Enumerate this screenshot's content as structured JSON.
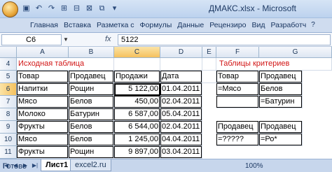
{
  "window": {
    "title": "ДМАКС.xlsx - Microsoft"
  },
  "ribbon": {
    "tabs": [
      "Главная",
      "Вставка",
      "Разметка с",
      "Формулы",
      "Данные",
      "Рецензиро",
      "Вид",
      "Разработч"
    ]
  },
  "formula_bar": {
    "name_box": "C6",
    "fx": "fx",
    "value": "5122"
  },
  "columns": [
    "A",
    "B",
    "C",
    "D",
    "E",
    "F",
    "G"
  ],
  "rows": [
    "4",
    "5",
    "6",
    "7",
    "8",
    "9",
    "10",
    "11"
  ],
  "sheet": {
    "left_title": "Исходная таблица",
    "right_title": "Таблицы критериев",
    "headers": [
      "Товар",
      "Продавец",
      "Продажи",
      "Дата"
    ],
    "data": [
      [
        "Напитки",
        "Рощин",
        "5 122,00",
        "01.04.2011"
      ],
      [
        "Мясо",
        "Белов",
        "450,00",
        "02.04.2011"
      ],
      [
        "Молоко",
        "Батурин",
        "6 587,00",
        "05.04.2011"
      ],
      [
        "Фрукты",
        "Белов",
        "6 544,00",
        "02.04.2011"
      ],
      [
        "Мясо",
        "Белов",
        "1 245,00",
        "04.04.2011"
      ],
      [
        "Фрукты",
        "Рощин",
        "9 897,00",
        "03.04.2011"
      ]
    ],
    "crit1_headers": [
      "Товар",
      "Продавец"
    ],
    "crit1_rows": [
      [
        "=Мясо",
        "Белов"
      ],
      [
        "",
        "=Батурин"
      ]
    ],
    "crit2_headers": [
      "Продавец",
      "Продавец"
    ],
    "crit2_rows": [
      [
        "=?????",
        "=Ро*"
      ]
    ]
  },
  "sheet_tabs": [
    "Лист1",
    "excel2.ru"
  ],
  "status": {
    "ready": "Готово",
    "zoom": "100%"
  }
}
